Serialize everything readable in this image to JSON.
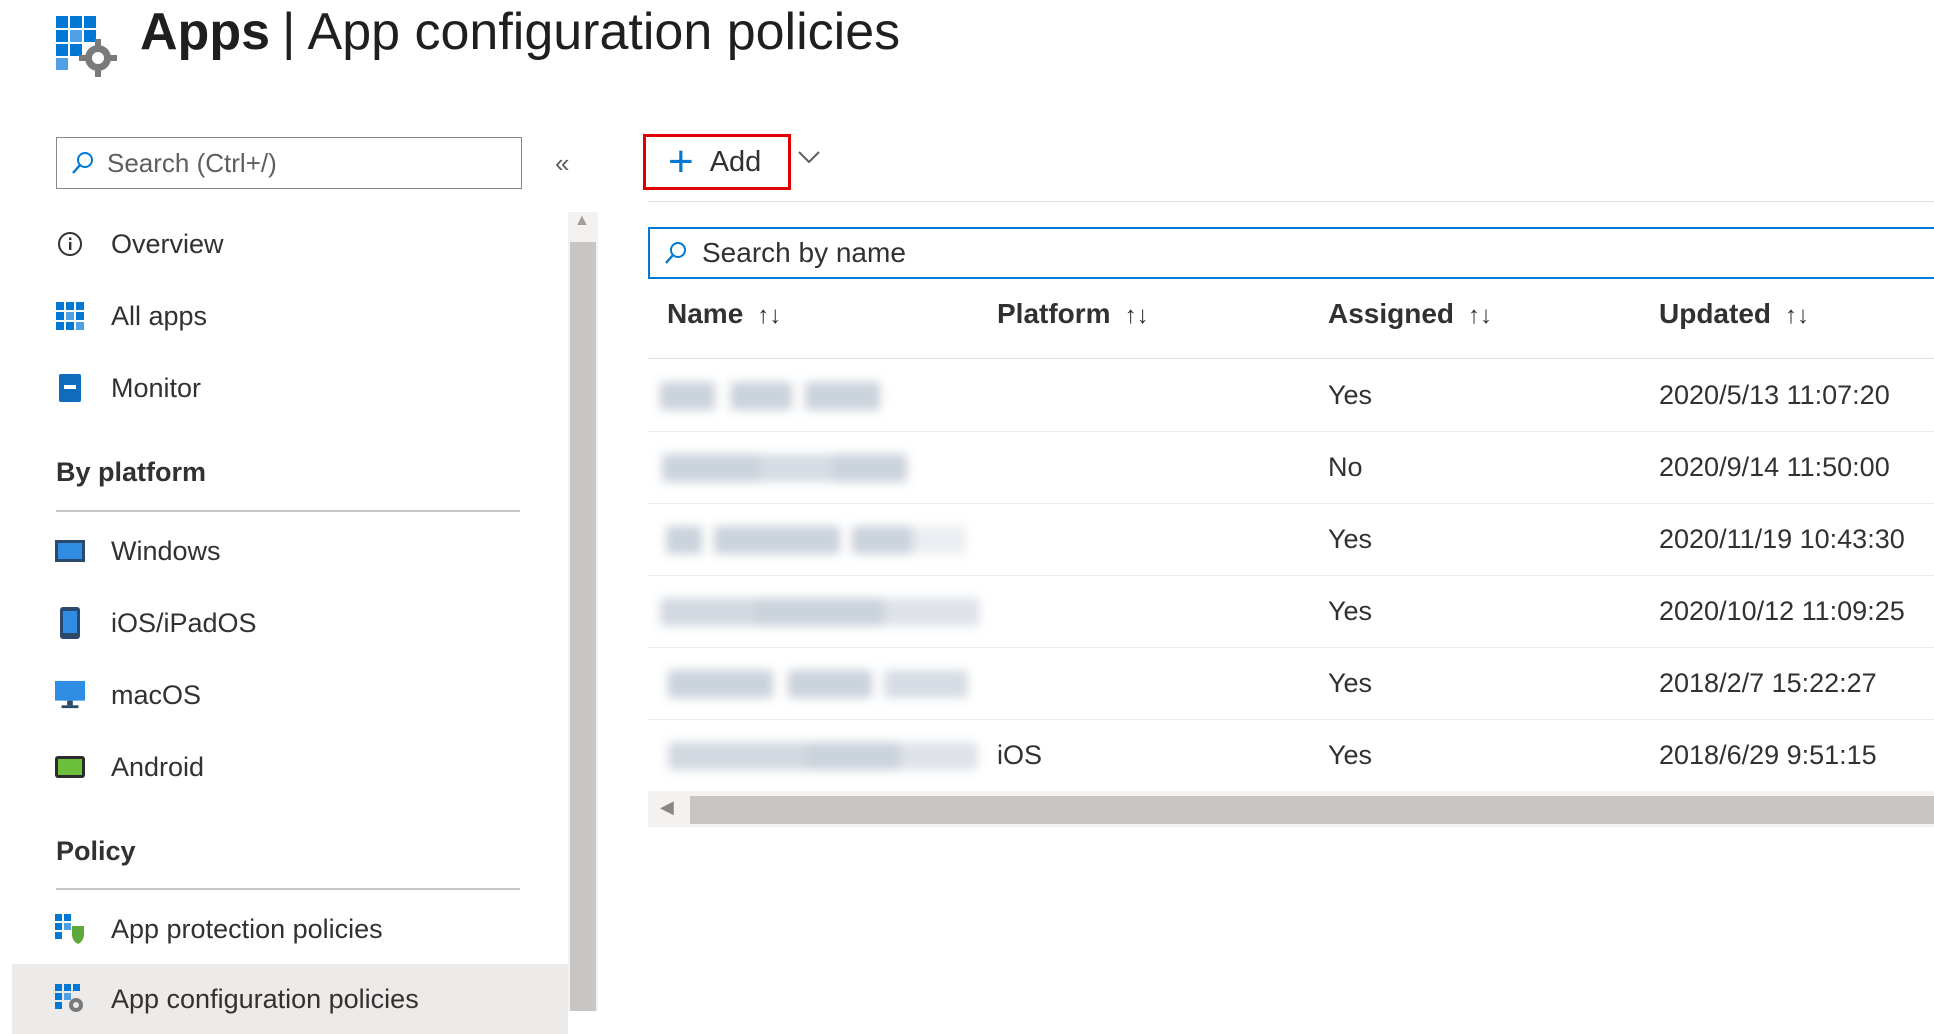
{
  "header": {
    "app_name": "Apps",
    "separator": "|",
    "page_name": "App configuration policies"
  },
  "sidebar": {
    "search": {
      "placeholder": "Search (Ctrl+/)",
      "value": ""
    },
    "collapse_glyph": "«",
    "top_items": [
      {
        "label": "Overview",
        "icon": "info-icon"
      },
      {
        "label": "All apps",
        "icon": "grid-icon"
      },
      {
        "label": "Monitor",
        "icon": "monitor-book-icon"
      }
    ],
    "sections": [
      {
        "title": "By platform",
        "items": [
          {
            "label": "Windows",
            "icon": "windows-device-icon"
          },
          {
            "label": "iOS/iPadOS",
            "icon": "phone-icon"
          },
          {
            "label": "macOS",
            "icon": "desktop-monitor-icon"
          },
          {
            "label": "Android",
            "icon": "tablet-icon"
          }
        ]
      },
      {
        "title": "Policy",
        "items": [
          {
            "label": "App protection policies",
            "icon": "app-protection-icon"
          },
          {
            "label": "App configuration policies",
            "icon": "app-configuration-icon",
            "active": true
          }
        ]
      }
    ]
  },
  "toolbar": {
    "add_label": "Add",
    "add_glyph": "+"
  },
  "table": {
    "search": {
      "placeholder": "Search by name",
      "value": ""
    },
    "columns": [
      "Name",
      "Platform",
      "Assigned",
      "Updated"
    ],
    "sort_glyph": "↑↓",
    "rows": [
      {
        "name": "",
        "platform": "",
        "assigned": "Yes",
        "updated": "2020/5/13 11:07:20"
      },
      {
        "name": "",
        "platform": "",
        "assigned": "No",
        "updated": "2020/9/14 11:50:00"
      },
      {
        "name": "",
        "platform": "",
        "assigned": "Yes",
        "updated": "2020/11/19 10:43:30"
      },
      {
        "name": "",
        "platform": "",
        "assigned": "Yes",
        "updated": "2020/10/12 11:09:25"
      },
      {
        "name": "",
        "platform": "",
        "assigned": "Yes",
        "updated": "2018/2/7 15:22:27"
      },
      {
        "name": "",
        "platform": "iOS",
        "assigned": "Yes",
        "updated": "2018/6/29 9:51:15"
      }
    ]
  },
  "colors": {
    "accent": "#0078d4",
    "highlight_border": "#e00000",
    "active_nav_bg": "#edebe9"
  }
}
